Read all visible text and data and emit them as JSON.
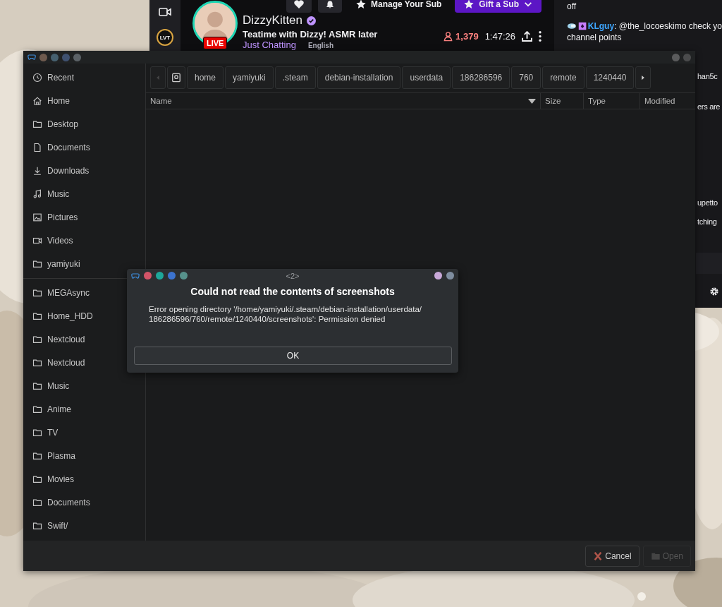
{
  "stream_window": {
    "rail": [
      {
        "kind": "camera"
      },
      {
        "kind": "channel",
        "label": "LVT"
      }
    ],
    "channel": {
      "name": "DizzyKitten",
      "verified": true,
      "live_badge": "LIVE",
      "title": "Teatime with Dizzy! ASMR later",
      "category": "Just Chatting",
      "tags": [
        "English"
      ]
    },
    "actions": [
      {
        "kind": "heart"
      },
      {
        "kind": "bell"
      },
      {
        "kind": "manage",
        "label": "Manage Your Sub"
      },
      {
        "kind": "gift",
        "label": "Gift a Sub"
      }
    ],
    "stats": {
      "viewers": "1,379",
      "uptime": "1:47:26"
    },
    "chat": [
      {
        "kind": "text",
        "text": "off"
      },
      {
        "kind": "message",
        "user": "KLguy",
        "color": "#3ea6ff",
        "separator": ":",
        "text": "@the_locoeskimo check yo"
      },
      {
        "kind": "text",
        "text": "channel points"
      },
      {
        "kind": "fragment",
        "text": "han5c"
      },
      {
        "kind": "fragment",
        "text": "ers are"
      },
      {
        "kind": "fragment",
        "text": "upetto"
      },
      {
        "kind": "fragment",
        "text": "tching"
      }
    ]
  },
  "file_window": {
    "sidebar": {
      "places": [
        {
          "kind": "clock",
          "label": "Recent"
        },
        {
          "kind": "home",
          "label": "Home"
        },
        {
          "kind": "folder",
          "label": "Desktop"
        },
        {
          "kind": "document",
          "label": "Documents"
        },
        {
          "kind": "download",
          "label": "Downloads"
        },
        {
          "kind": "music",
          "label": "Music"
        },
        {
          "kind": "picture",
          "label": "Pictures"
        },
        {
          "kind": "video",
          "label": "Videos"
        },
        {
          "kind": "folder",
          "label": "yamiyuki"
        }
      ],
      "bookmarks": [
        {
          "kind": "folder",
          "label": "MEGAsync"
        },
        {
          "kind": "folder",
          "label": "Home_HDD"
        },
        {
          "kind": "folder",
          "label": "Nextcloud"
        },
        {
          "kind": "folder",
          "label": "Nextcloud"
        },
        {
          "kind": "folder",
          "label": "Music"
        },
        {
          "kind": "folder",
          "label": "Anime"
        },
        {
          "kind": "folder",
          "label": "TV"
        },
        {
          "kind": "folder",
          "label": "Plasma"
        },
        {
          "kind": "folder",
          "label": "Movies"
        },
        {
          "kind": "folder",
          "label": "Documents"
        },
        {
          "kind": "folder",
          "label": "Swift/"
        }
      ]
    },
    "path_bar": {
      "crumbs": [
        "home",
        "yamiyuki",
        ".steam",
        "debian-installation",
        "userdata",
        "186286596",
        "760",
        "remote",
        "1240440"
      ]
    },
    "columns": [
      {
        "label": "Name",
        "sorted": true
      },
      {
        "label": "Size",
        "sorted": false
      },
      {
        "label": "Type",
        "sorted": false
      },
      {
        "label": "Modified",
        "sorted": false
      }
    ],
    "buttons": [
      {
        "kind": "cancel",
        "label": "Cancel",
        "disabled": false
      },
      {
        "kind": "open",
        "label": "Open",
        "disabled": true
      }
    ]
  },
  "dialog": {
    "title": "<2>",
    "heading": "Could not read the contents of screenshots",
    "message": "Error opening directory '/home/yamiyuki/.steam/debian-installation/userdata/\n186286596/760/remote/1240440/screenshots': Permission denied",
    "button": "OK"
  }
}
